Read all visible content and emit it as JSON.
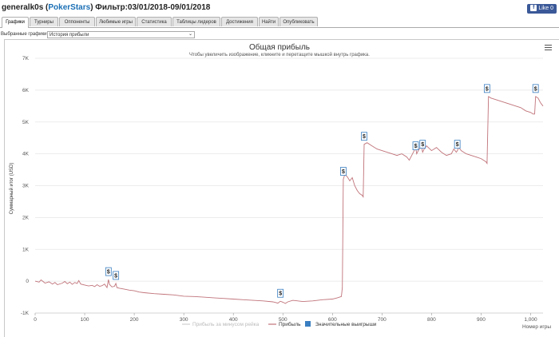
{
  "header": {
    "player": "generalk0s",
    "site": "PokerStars",
    "filter": "Фильтр:03/01/2018-09/01/2018",
    "like_label": "Like 0"
  },
  "tabs": [
    {
      "label": "Графики",
      "active": true
    },
    {
      "label": "Турниры",
      "active": false
    },
    {
      "label": "Оппоненты",
      "active": false
    },
    {
      "label": "Любимые игры",
      "active": false
    },
    {
      "label": "Статистика",
      "active": false
    },
    {
      "label": "Таблицы лидеров",
      "active": false
    },
    {
      "label": "Достижения",
      "active": false
    },
    {
      "label": "Найти",
      "active": false
    },
    {
      "label": "Опубликовать",
      "active": false
    }
  ],
  "selector": {
    "label": "Выбранные графики:",
    "value": "История прибыли"
  },
  "chart_data": {
    "type": "line",
    "title": "Общая прибыль",
    "subtitle": "Чтобы увеличить изображение, кликните и перетащите мышкой внутрь графика.",
    "ylabel": "Суммарный итог (USD)",
    "xlabel": "Номер игры",
    "ylim": [
      -1000,
      7000
    ],
    "xlim": [
      0,
      1025
    ],
    "y_ticks": [
      "-1K",
      "0",
      "1K",
      "2K",
      "3K",
      "4K",
      "5K",
      "6K",
      "7K"
    ],
    "x_ticks": [
      "0",
      "100",
      "200",
      "300",
      "400",
      "500",
      "600",
      "700",
      "800",
      "900",
      "1,000"
    ],
    "grid": true,
    "legend_position": "bottom",
    "legend": [
      {
        "name": "Прибыль за минусом рейка",
        "color": "#cfcfcf"
      },
      {
        "name": "Прибыль",
        "color": "#c0737a"
      },
      {
        "name": "Значительные выигрыши",
        "color": "#3a7fc1"
      }
    ],
    "series": [
      {
        "name": "Прибыль",
        "color": "#c0737a",
        "x": [
          0,
          8,
          12,
          20,
          28,
          35,
          40,
          45,
          55,
          60,
          65,
          70,
          75,
          80,
          85,
          88,
          92,
          100,
          108,
          115,
          120,
          125,
          130,
          135,
          140,
          145,
          148,
          150,
          155,
          160,
          163,
          165,
          170,
          180,
          190,
          200,
          210,
          220,
          240,
          260,
          280,
          300,
          320,
          340,
          360,
          380,
          400,
          420,
          440,
          460,
          480,
          490,
          495,
          500,
          505,
          510,
          520,
          540,
          560,
          580,
          600,
          610,
          618,
          620,
          622,
          625,
          630,
          635,
          640,
          645,
          650,
          655,
          660,
          662,
          664,
          670,
          680,
          690,
          700,
          710,
          720,
          730,
          740,
          750,
          755,
          760,
          765,
          768,
          770,
          775,
          780,
          782,
          785,
          790,
          800,
          810,
          820,
          830,
          840,
          845,
          850,
          852,
          855,
          860,
          870,
          880,
          890,
          900,
          910,
          912,
          915,
          920,
          930,
          940,
          950,
          960,
          970,
          980,
          990,
          1000,
          1005,
          1008,
          1010,
          1015,
          1020,
          1025
        ],
        "y": [
          0,
          -30,
          40,
          -60,
          -20,
          -90,
          -40,
          -110,
          -60,
          -10,
          -80,
          -30,
          -100,
          -40,
          -70,
          20,
          -90,
          -120,
          -150,
          -130,
          -170,
          -110,
          -160,
          -140,
          -90,
          -200,
          50,
          -100,
          -180,
          -160,
          -70,
          -200,
          -220,
          -250,
          -280,
          -300,
          -340,
          -360,
          -390,
          -410,
          -430,
          -470,
          -480,
          -500,
          -520,
          -540,
          -560,
          -580,
          -600,
          -620,
          -650,
          -690,
          -630,
          -660,
          -700,
          -650,
          -600,
          -640,
          -620,
          -580,
          -560,
          -520,
          -480,
          -200,
          3200,
          3350,
          3280,
          3150,
          3250,
          3000,
          2850,
          2750,
          2700,
          2650,
          4300,
          4350,
          4250,
          4150,
          4100,
          4050,
          4000,
          3950,
          4000,
          3900,
          3800,
          3950,
          4100,
          4200,
          4000,
          4150,
          4200,
          4050,
          4150,
          4250,
          4100,
          4200,
          4050,
          3950,
          4000,
          4150,
          4050,
          4100,
          4200,
          4100,
          4000,
          3950,
          3900,
          3850,
          3750,
          3700,
          5800,
          5750,
          5700,
          5650,
          5600,
          5550,
          5500,
          5450,
          5350,
          5300,
          5250,
          5250,
          5800,
          5750,
          5600,
          5500
        ]
      }
    ],
    "big_wins_label": "$",
    "big_wins": [
      {
        "x": 148,
        "y": 50
      },
      {
        "x": 163,
        "y": -70
      },
      {
        "x": 495,
        "y": -630
      },
      {
        "x": 622,
        "y": 3200
      },
      {
        "x": 664,
        "y": 4300
      },
      {
        "x": 768,
        "y": 4000
      },
      {
        "x": 782,
        "y": 4050
      },
      {
        "x": 852,
        "y": 4050
      },
      {
        "x": 912,
        "y": 5800
      },
      {
        "x": 1010,
        "y": 5800
      }
    ]
  }
}
